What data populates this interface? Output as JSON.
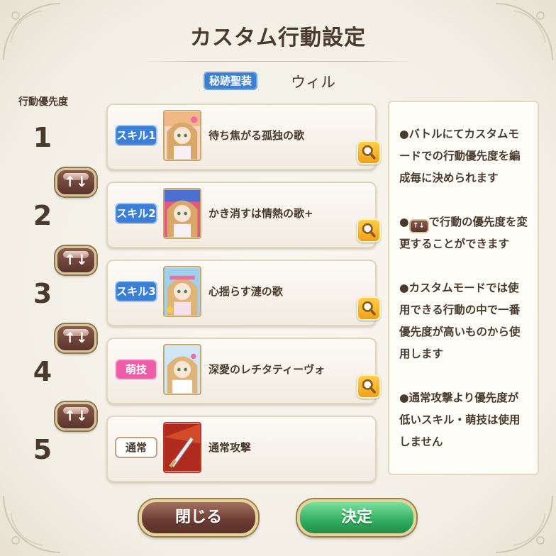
{
  "window": {
    "title": "カスタム行動設定",
    "equipment_badge": "秘跡聖装",
    "character_name": "ウィル"
  },
  "priority_label": "行動優先度",
  "rows": [
    {
      "number": "1",
      "tag": "スキル1",
      "tag_color": "#3a7fd5",
      "name": "待ち焦がる孤独の歌",
      "zoom_icon": "magnifier-icon"
    },
    {
      "number": "2",
      "tag": "スキル2",
      "tag_color": "#3a7fd5",
      "name": "かき消すは情熱の歌+",
      "zoom_icon": "magnifier-icon"
    },
    {
      "number": "3",
      "tag": "スキル3",
      "tag_color": "#3a7fd5",
      "name": "心揺らす漣の歌",
      "zoom_icon": "magnifier-icon"
    },
    {
      "number": "4",
      "tag": "萌技",
      "tag_color": "#ec5fa6",
      "name": "深愛のレチタティーヴォ",
      "zoom_icon": "magnifier-icon"
    },
    {
      "number": "5",
      "tag": "通常",
      "tag_color": "#ffffff",
      "name": "通常攻撃"
    }
  ],
  "swap_button": {
    "label": "↑↓"
  },
  "info": {
    "p1": "●バトルにてカスタムモードでの行動優先度を編成毎に決められます",
    "p2_prefix": "●",
    "p2_suffix": "で行動の優先度を変更することができます",
    "p3": "●カスタムモードでは使用できる行動の中で一番優先度が高いものから使用します",
    "p4": "●通常攻撃より優先度が低いスキル・萌技は使用しません"
  },
  "buttons": {
    "close": "閉じる",
    "confirm": "決定"
  },
  "colors": {
    "close_button": "#6b3d33",
    "confirm_button": "#2fae5c",
    "zoom_button": "#f0a018"
  }
}
